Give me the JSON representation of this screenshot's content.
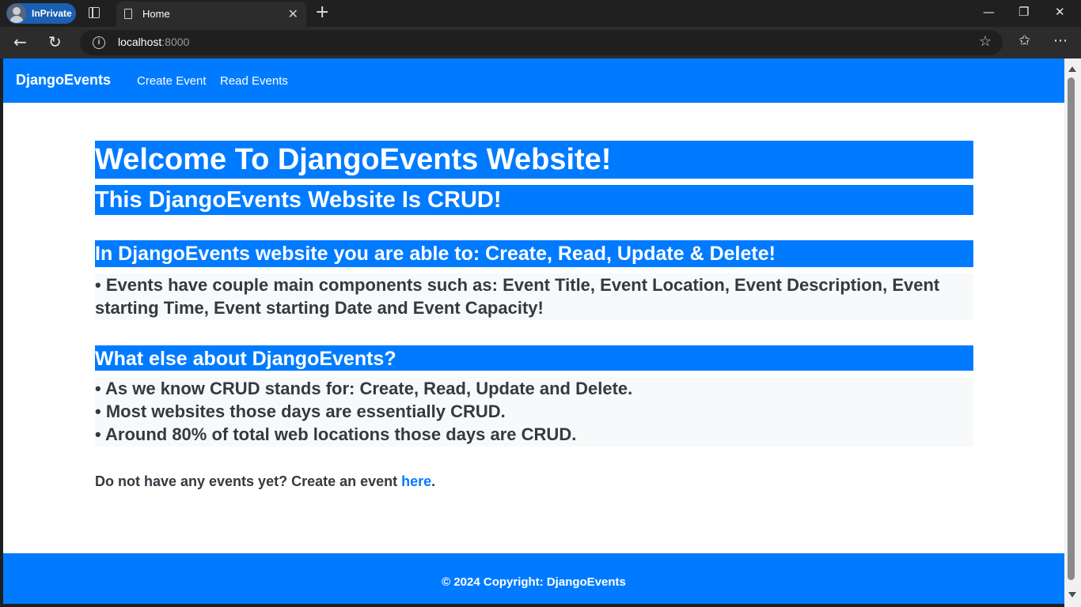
{
  "browser": {
    "inprivate_label": "InPrivate",
    "tab_title": "Home",
    "tab_close": "✕",
    "new_tab": "+",
    "url_host": "localhost",
    "url_port": ":8000",
    "window_controls": {
      "minimize": "—",
      "restore": "❐",
      "close": "✕"
    }
  },
  "navbar": {
    "brand": "DjangoEvents",
    "links": [
      "Create Event",
      "Read Events"
    ]
  },
  "main": {
    "heading1": "Welcome To DjangoEvents Website!",
    "heading2": "This DjangoEvents Website Is CRUD!",
    "section1": {
      "heading": "In DjangoEvents website you are able to: Create, Read, Update & Delete!",
      "bullets": [
        "• Events have couple main components such as: Event Title, Event Location, Event Description, Event starting Time, Event starting Date and Event Capacity!"
      ]
    },
    "section2": {
      "heading": "What else about DjangoEvents?",
      "bullets": [
        "• As we know CRUD stands for: Create, Read, Update and Delete.",
        "• Most websites those days are essentially CRUD.",
        "• Around 80% of total web locations those days are CRUD."
      ]
    },
    "cta": {
      "text": "Do not have any events yet? Create an event ",
      "link": "here",
      "end": "."
    }
  },
  "footer": {
    "text": "© 2024 Copyright: DjangoEvents"
  },
  "colors": {
    "primary": "#007bff",
    "light": "#f8f9fa",
    "text_dark": "#343a40"
  }
}
